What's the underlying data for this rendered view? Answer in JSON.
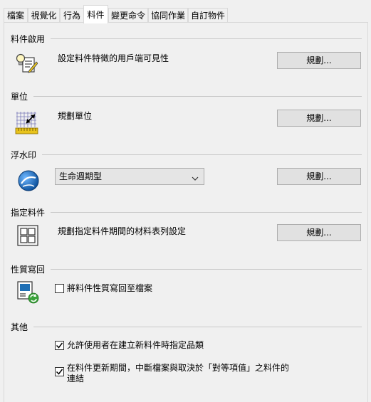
{
  "tabs": [
    "檔案",
    "視覺化",
    "行為",
    "料件",
    "變更命令",
    "協同作業",
    "自訂物件"
  ],
  "active_tab": "料件",
  "sections": {
    "item_enable": {
      "title": "料件啟用",
      "description": "設定料件特徵的用戶端可見性",
      "button": "規劃..."
    },
    "units": {
      "title": "單位",
      "description": "規劃單位",
      "button": "規劃..."
    },
    "watermark": {
      "title": "浮水印",
      "select_value": "生命週期型",
      "button": "規劃..."
    },
    "assign_items": {
      "title": "指定料件",
      "description": "規劃指定料件期間的材料表列設定",
      "button": "規劃..."
    },
    "property_writeback": {
      "title": "性質寫回",
      "checkbox_label": "將料件性質寫回至檔案",
      "checked": false
    },
    "other": {
      "title": "其他",
      "options": [
        {
          "label": "允許使用者在建立新料件時指定品類",
          "checked": true
        },
        {
          "label": "在料件更新期間，中斷檔案與取決於「對等項值」之料件的連結",
          "checked": true
        }
      ]
    }
  },
  "colors": {
    "panel_bg": "#f0f0f0",
    "button_bg": "#e1e1e1",
    "accent_blue": "#1f6fb5",
    "icon_green": "#3aa33a",
    "icon_yellow": "#e8c31c"
  }
}
